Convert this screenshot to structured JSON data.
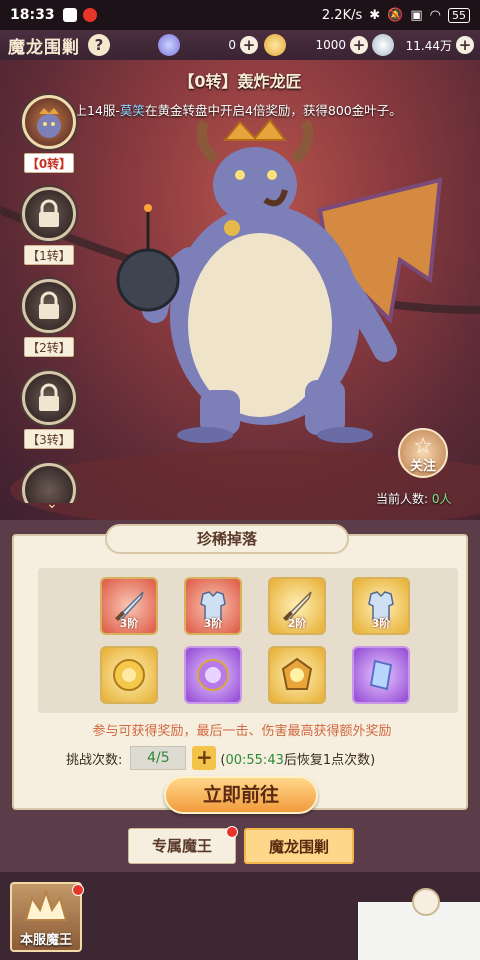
{
  "status_bar": {
    "time": "18:33",
    "network_speed": "2.2K/s",
    "battery": "55"
  },
  "header": {
    "title": "魔龙围剿",
    "help_label": "?",
    "currencies": [
      {
        "icon": "diamond-icon",
        "value": "0"
      },
      {
        "icon": "leaf-icon",
        "value": "1000"
      },
      {
        "icon": "silver-orb-icon",
        "value": "11.44万"
      }
    ],
    "plus_label": "+"
  },
  "boss": {
    "name_header": "【0转】轰炸龙匠",
    "announcement": {
      "prefix": "云上14服-",
      "player": "莫笑",
      "suffix": "在黄金转盘中开启4倍奖励，获得800金叶子。"
    }
  },
  "tiers": [
    {
      "label": "【0转】",
      "locked": false,
      "active": true
    },
    {
      "label": "【1转】",
      "locked": true,
      "active": false
    },
    {
      "label": "【2转】",
      "locked": true,
      "active": false
    },
    {
      "label": "【3转】",
      "locked": true,
      "active": false
    }
  ],
  "follow": {
    "label": "关注",
    "viewers_prefix": "当前人数: ",
    "viewers_count": "0人"
  },
  "drops": {
    "title": "珍稀掉落",
    "items": [
      {
        "icon": "sword-icon",
        "quality": "red",
        "tier": "3阶"
      },
      {
        "icon": "armor-icon",
        "quality": "red",
        "tier": "3阶"
      },
      {
        "icon": "sword-icon",
        "quality": "gold",
        "tier": "2阶"
      },
      {
        "icon": "armor-icon",
        "quality": "gold",
        "tier": "3阶"
      },
      {
        "icon": "gold-orb-icon",
        "quality": "gold",
        "tier": ""
      },
      {
        "icon": "purple-orb-icon",
        "quality": "purple",
        "tier": ""
      },
      {
        "icon": "gem-rune-icon",
        "quality": "gold",
        "tier": ""
      },
      {
        "icon": "crystal-shard-icon",
        "quality": "purple",
        "tier": ""
      }
    ],
    "hint": "参与可获得奖励，最后一击、伤害最高获得额外奖励",
    "attempts_label": "挑战次数:",
    "attempts_value": "4/5",
    "recover_prefix": "(",
    "recover_time": "00:55:43",
    "recover_suffix": "后恢复1点次数)",
    "go_label": "立即前往"
  },
  "tabs": [
    {
      "label": "专属魔王",
      "selected": false
    },
    {
      "label": "魔龙围剿",
      "selected": true
    }
  ],
  "bottom": {
    "server_boss_label": "本服魔王"
  },
  "colors": {
    "panel_bg": "#f6efe0",
    "accent_gold": "#f29a3c",
    "highlight_green": "#2d8a3a",
    "hint_orange": "#d1683f"
  }
}
